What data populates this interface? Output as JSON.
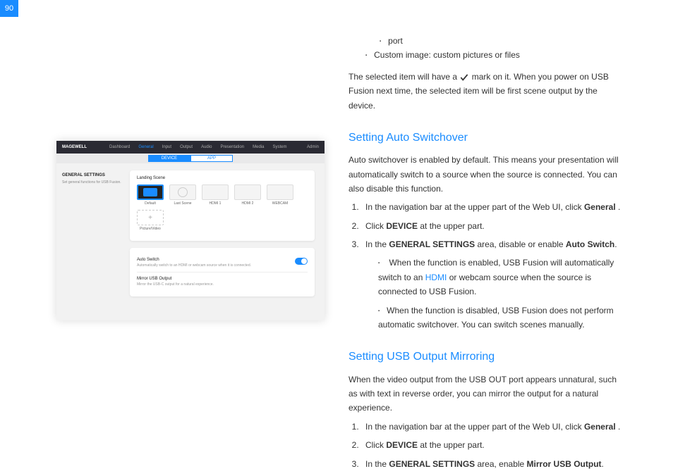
{
  "page_number": "90",
  "intro": {
    "bullet_port": "port",
    "bullet_custom": "Custom image: custom pictures or files",
    "para_pre": "The selected item will have a ",
    "para_post": " mark on it. When you power on USB Fusion next time, the selected item will be first scene output by the device."
  },
  "screenshot": {
    "brand": "MAGEWELL",
    "nav": [
      "Dashboard",
      "General",
      "Input",
      "Output",
      "Audio",
      "Presentation",
      "Media",
      "System"
    ],
    "nav_active_index": 1,
    "admin": "Admin",
    "tab_device": "DEVICE",
    "tab_app": "APP",
    "side_title": "GENERAL SETTINGS",
    "side_sub": "Set general functions for USB Fusion.",
    "landing_label": "Landing Scene",
    "thumbs": [
      "Default",
      "Last Scene",
      "HDMI 1",
      "HDMI 2",
      "WEBCAM"
    ],
    "picture_video": "Picture/Video",
    "row1_title": "Auto Switch",
    "row1_desc": "Automatically switch to an HDMI or webcam source when it is connected.",
    "row2_title": "Mirror USB Output",
    "row2_desc": "Mirror the USB-C output for a natural experience."
  },
  "section1": {
    "heading": "Setting Auto Switchover",
    "intro": "Auto switchover is enabled by default. This means your presentation will automatically switch to a source when the source is connected. You can also disable this function.",
    "step1_pre": "In the navigation bar at the upper part of the Web UI, click ",
    "step1_bold": "General",
    "step1_post": " .",
    "step2_pre": "Click ",
    "step2_bold": "DEVICE",
    "step2_post": " at the upper part.",
    "step3_pre": "In the ",
    "step3_bold1": "GENERAL SETTINGS",
    "step3_mid": " area, disable or enable ",
    "step3_bold2": "Auto Switch",
    "step3_post": ".",
    "sub1_pre": "When the function is enabled, USB Fusion will automatically switch to an ",
    "sub1_link": "HDMI",
    "sub1_post": " or webcam source when the source is connected to USB Fusion.",
    "sub2": "When the function is disabled, USB Fusion does not perform automatic switchover. You can switch scenes manually."
  },
  "section2": {
    "heading": "Setting USB Output Mirroring",
    "intro": "When the video output from the USB OUT port appears unnatural, such as with text in reverse order, you can mirror the output for a natural experience.",
    "step1_pre": "In the navigation bar at the upper part of the Web UI, click ",
    "step1_bold": "General",
    "step1_post": " .",
    "step2_pre": "Click ",
    "step2_bold": "DEVICE",
    "step2_post": " at the upper part.",
    "step3_pre": "In the ",
    "step3_bold1": "GENERAL SETTINGS",
    "step3_mid": " area, enable ",
    "step3_bold2": "Mirror USB Output",
    "step3_post": "."
  }
}
